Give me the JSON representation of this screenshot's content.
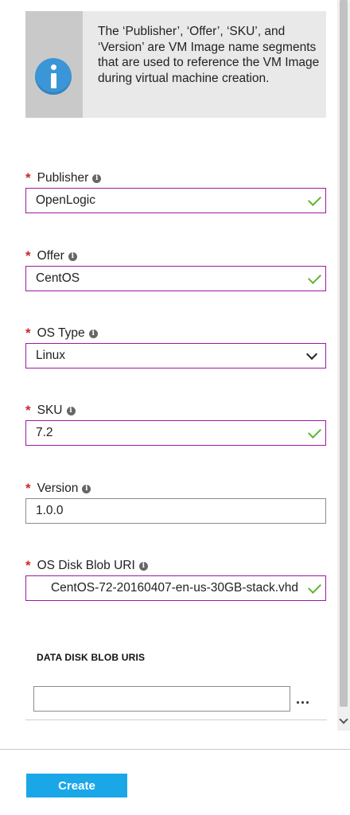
{
  "info": {
    "icon": "info-icon",
    "text": "The ‘Publisher’, ‘Offer’, ‘SKU’, and ‘Version’ are VM Image name segments that are used to reference the VM Image during virtual machine creation."
  },
  "fields": {
    "publisher": {
      "label": "Publisher",
      "value": "OpenLogic"
    },
    "offer": {
      "label": "Offer",
      "value": "CentOS"
    },
    "os_type": {
      "label": "OS Type",
      "value": "Linux"
    },
    "sku": {
      "label": "SKU",
      "value": "7.2"
    },
    "version": {
      "label": "Version",
      "value": "1.0.0"
    },
    "os_disk_blob_uri": {
      "label": "OS Disk Blob URI",
      "value": "CentOS-72-20160407-en-us-30GB-stack.vhd"
    }
  },
  "required_marker": "*",
  "help_glyph": "i",
  "data_disk": {
    "heading": "DATA DISK BLOB URIS",
    "value": "",
    "browse_label": "..."
  },
  "footer": {
    "create_label": "Create"
  },
  "colors": {
    "accent": "#1aa7e8",
    "valid_check": "#5fb532",
    "required": "#cc2929",
    "focus_border": "#9c1aa0"
  }
}
